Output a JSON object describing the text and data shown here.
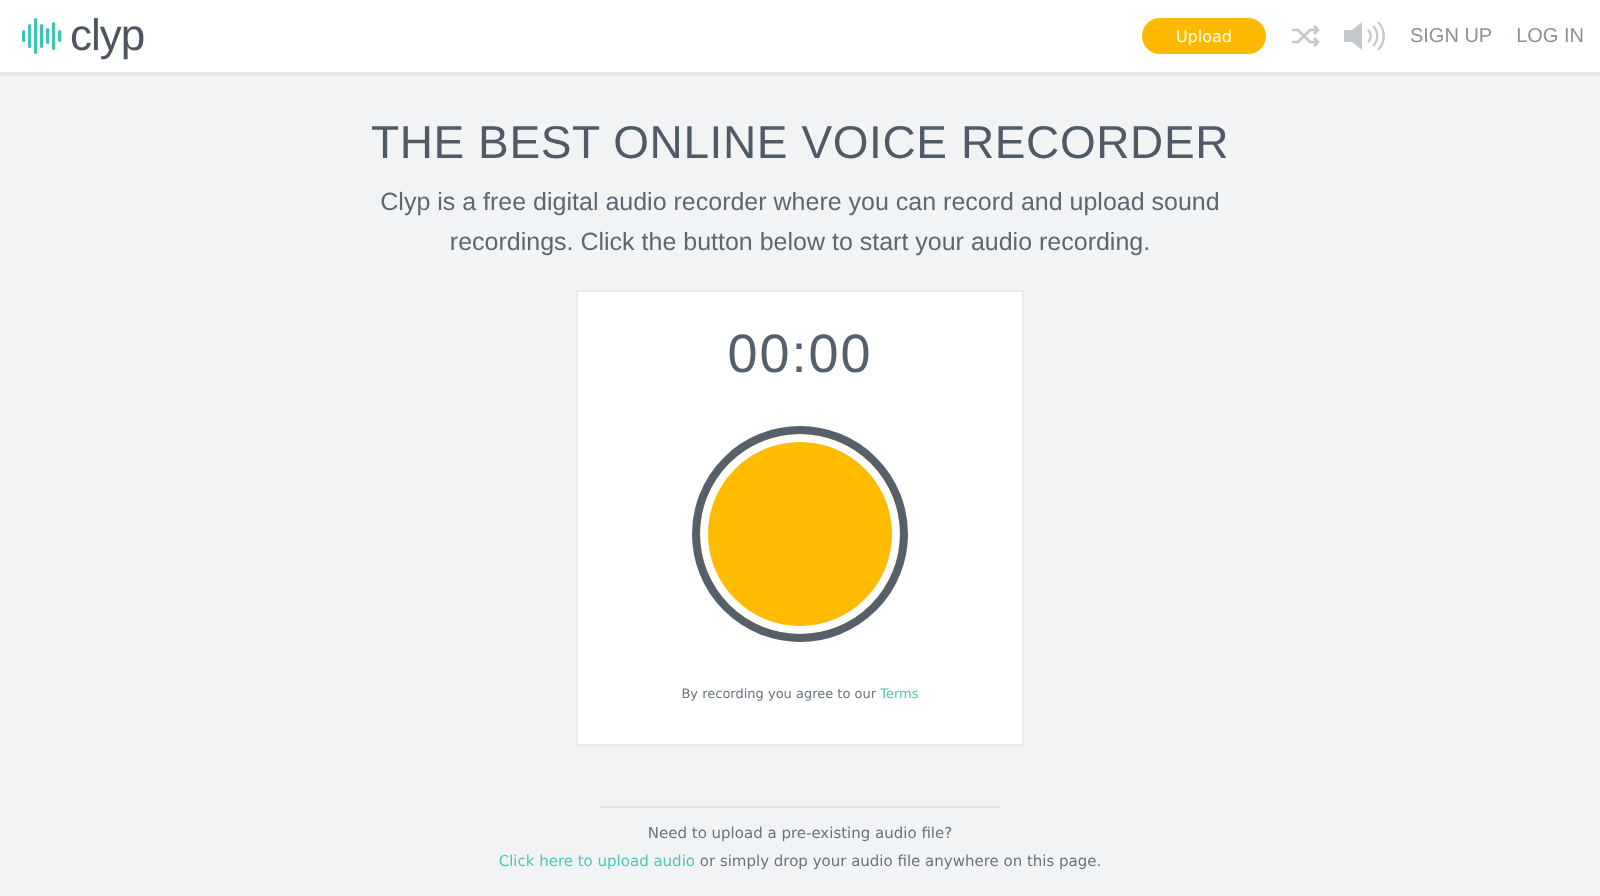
{
  "header": {
    "logo": "clyp",
    "upload_button": "Upload",
    "nav": [
      "SIGN UP",
      "LOG IN"
    ]
  },
  "hero": {
    "title": "THE BEST ONLINE VOICE RECORDER",
    "description": "Clyp is a free digital audio recorder where you can record and upload sound recordings. Click the button below to start your audio recording."
  },
  "recorder": {
    "timer": "00:00",
    "terms_text": "By recording you agree to our ",
    "terms_link": "Terms"
  },
  "upload_hint": {
    "question": "Need to upload a pre-existing audio file?",
    "link": "Click here to upload audio",
    "rest": " or simply drop your audio file anywhere on this page."
  }
}
